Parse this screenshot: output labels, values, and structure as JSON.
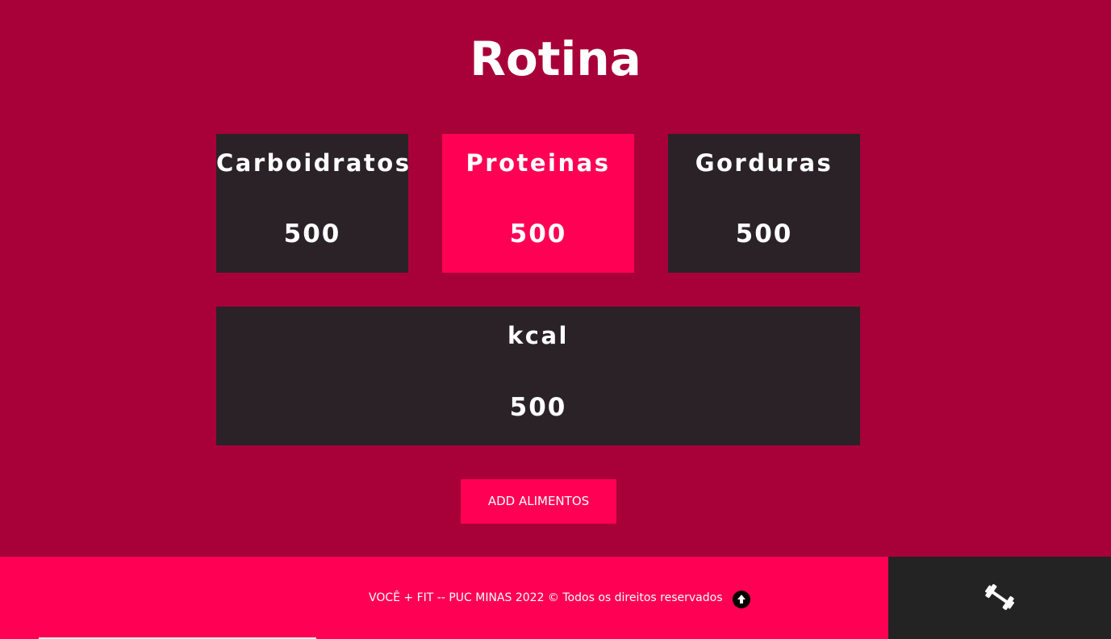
{
  "page": {
    "title": "Rotina"
  },
  "macros": {
    "carbs": {
      "label": "Carboidratos",
      "value": "500"
    },
    "protein": {
      "label": "Proteinas",
      "value": "500"
    },
    "fat": {
      "label": "Gorduras",
      "value": "500"
    },
    "kcal": {
      "label": "kcal",
      "value": "500"
    }
  },
  "actions": {
    "add_food_label": "ADD ALIMENTOS"
  },
  "footer": {
    "text": "VOCÊ + FIT -- PUC MINAS 2022 © Todos os direitos reservados",
    "back_to_top_icon": "arrow-up-circle-icon",
    "brand_icon": "dumbbell-icon"
  },
  "colors": {
    "background": "#a80038",
    "accent": "#ff0055",
    "card_dark": "#2a2226",
    "footer_dark": "#232323",
    "text": "#ffffff"
  }
}
